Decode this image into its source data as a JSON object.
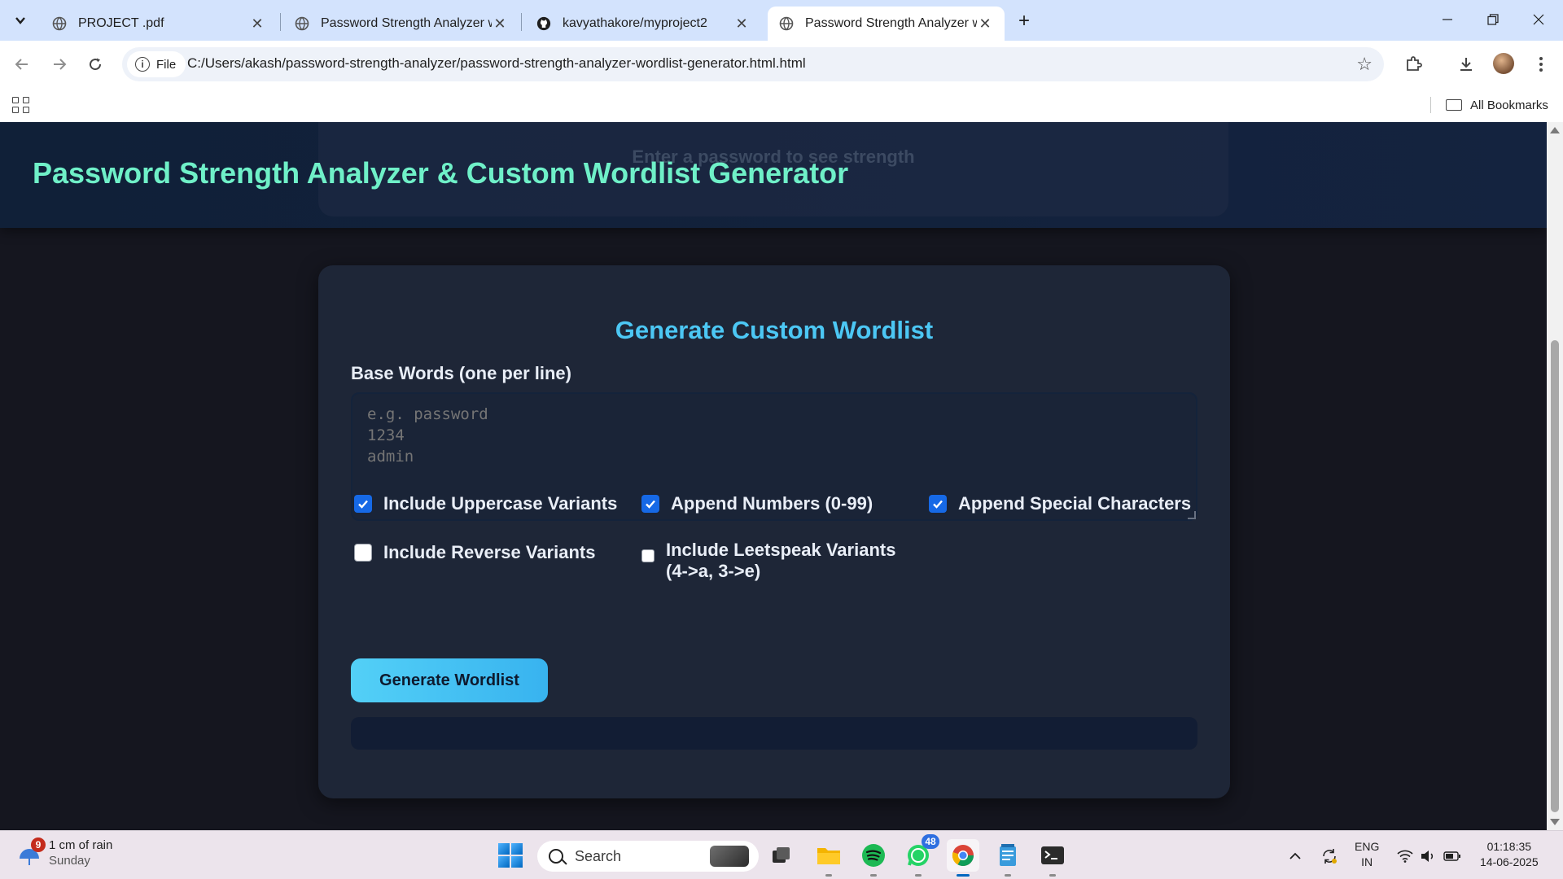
{
  "browser": {
    "tabs": [
      {
        "title": "PROJECT .pdf",
        "active": false
      },
      {
        "title": "Password Strength Analyzer wit",
        "active": false
      },
      {
        "title": "kavyathakore/myproject2",
        "active": false
      },
      {
        "title": "Password Strength Analyzer wit",
        "active": true
      }
    ],
    "omnibox": {
      "chip_label": "File",
      "url": "C:/Users/akash/password-strength-analyzer/password-strength-analyzer-wordlist-generator.html.html"
    },
    "bookmarks": {
      "all_bookmarks_label": "All Bookmarks"
    }
  },
  "page": {
    "header_title": "Password Strength Analyzer & Custom Wordlist Generator",
    "strength_placeholder": "Enter a password to see strength",
    "wordlist": {
      "heading": "Generate Custom Wordlist",
      "base_words_label": "Base Words (one per line)",
      "base_words_placeholder": "e.g. password\n1234\nadmin",
      "options": [
        {
          "label": "Include Uppercase Variants",
          "checked": true
        },
        {
          "label": "Append Numbers (0-99)",
          "checked": true
        },
        {
          "label": "Append Special Characters",
          "checked": true
        },
        {
          "label": "Include Reverse Variants",
          "checked": false
        },
        {
          "label": "Include Leetspeak Variants (4->a, 3->e)",
          "checked": false
        }
      ],
      "generate_button": "Generate Wordlist",
      "output": ""
    }
  },
  "taskbar": {
    "weather": {
      "badge": "9",
      "title": "1 cm of rain",
      "subtitle": "Sunday"
    },
    "search_placeholder": "Search",
    "whatsapp_badge": "48",
    "language": {
      "line1": "ENG",
      "line2": "IN"
    },
    "clock": {
      "time": "01:18:35",
      "date": "14-06-2025"
    }
  },
  "colors": {
    "header_title": "#6ff0c8",
    "heading": "#4cc7f4",
    "checkbox_on": "#1669e6",
    "button_gradient_start": "#53d0f7",
    "button_gradient_end": "#38b3ef"
  }
}
